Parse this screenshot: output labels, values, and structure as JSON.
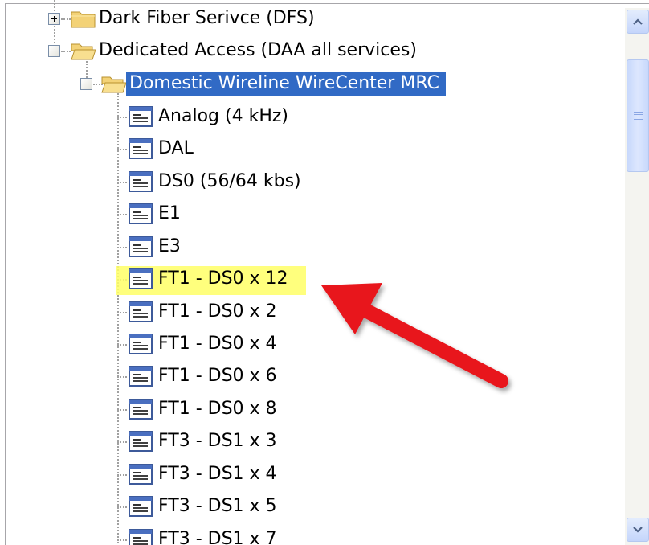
{
  "tree": {
    "nodes": [
      {
        "label": "Dark Fiber Serivce (DFS)",
        "type": "folder",
        "expanded": false
      },
      {
        "label": "Dedicated Access (DAA all services)",
        "type": "folder",
        "expanded": true
      },
      {
        "label": "Domestic Wireline WireCenter MRC",
        "type": "folder",
        "expanded": true,
        "selected": true
      },
      {
        "label": "Analog (4 kHz)",
        "type": "leaf"
      },
      {
        "label": "DAL",
        "type": "leaf"
      },
      {
        "label": "DS0 (56/64 kbs)",
        "type": "leaf"
      },
      {
        "label": "E1",
        "type": "leaf"
      },
      {
        "label": "E3",
        "type": "leaf"
      },
      {
        "label": "FT1 - DS0 x 12",
        "type": "leaf",
        "highlighted": true
      },
      {
        "label": "FT1 - DS0 x 2",
        "type": "leaf"
      },
      {
        "label": "FT1 - DS0 x 4",
        "type": "leaf"
      },
      {
        "label": "FT1 - DS0 x 6",
        "type": "leaf"
      },
      {
        "label": "FT1 - DS0 x 8",
        "type": "leaf"
      },
      {
        "label": "FT3 - DS1 x 3",
        "type": "leaf"
      },
      {
        "label": "FT3 - DS1 x 4",
        "type": "leaf"
      },
      {
        "label": "FT3 - DS1 x 5",
        "type": "leaf"
      },
      {
        "label": "FT3 - DS1 x 7",
        "type": "leaf"
      }
    ]
  },
  "colors": {
    "selection": "#316ac5",
    "highlight": "#ffff66",
    "annotation_arrow": "#e8141b"
  },
  "icons": {
    "folder_closed": "folder-icon",
    "folder_open": "folder-open-icon",
    "leaf": "list-document-icon",
    "expand": "plus-icon",
    "collapse": "minus-icon"
  }
}
